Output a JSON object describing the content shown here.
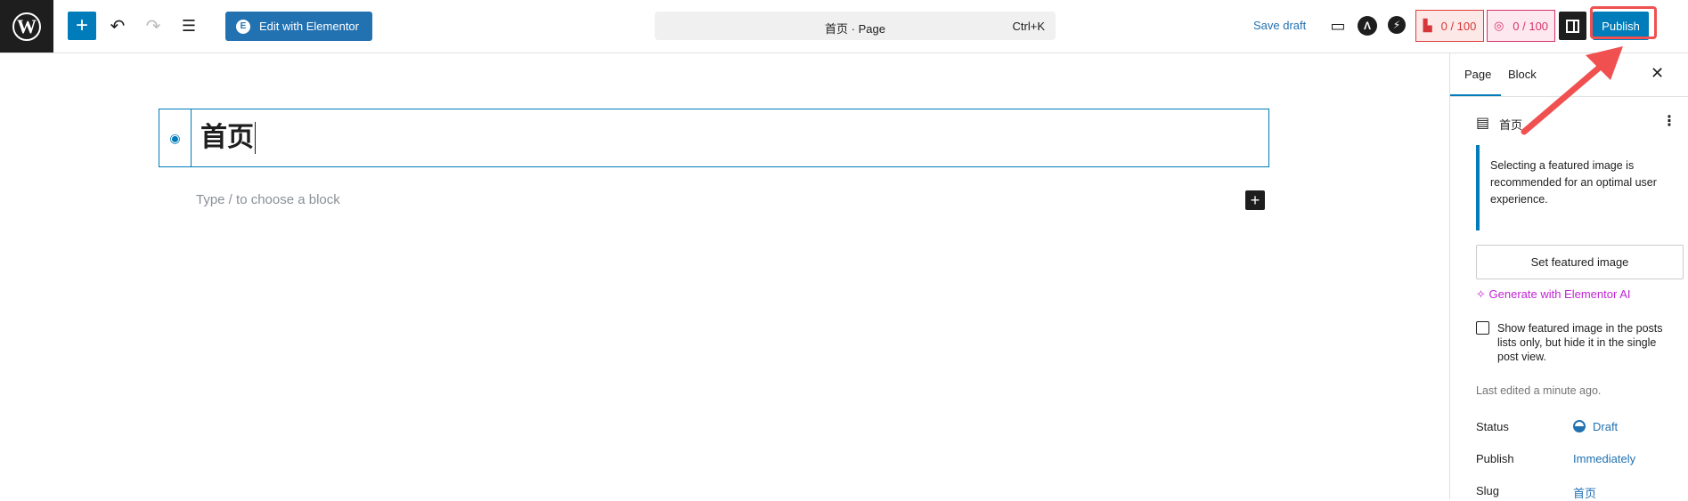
{
  "header": {
    "logo": "WordPress",
    "add_block": "+",
    "elementor_button": "Edit with Elementor",
    "command_bar": {
      "title": "首页 · Page",
      "shortcut": "Ctrl+K"
    },
    "save_draft": "Save draft",
    "seo_score_1": "0 / 100",
    "seo_score_2": "0 / 100",
    "publish": "Publish"
  },
  "editor": {
    "title": "首页",
    "placeholder": "Type / to choose a block"
  },
  "sidebar": {
    "tabs": [
      "Page",
      "Block"
    ],
    "page_title": "首页",
    "notice": "Selecting a featured image is recommended for an optimal user experience.",
    "set_featured_image": "Set featured image",
    "generate_ai": "Generate with Elementor AI",
    "checkbox_label": "Show featured image in the posts lists only, but hide it in the single post view.",
    "last_edited": "Last edited a minute ago.",
    "fields": [
      {
        "label": "Status",
        "value": "Draft"
      },
      {
        "label": "Publish",
        "value": "Immediately"
      },
      {
        "label": "Slug",
        "value": "首页"
      }
    ]
  },
  "colors": {
    "accent": "#007cba",
    "annotation": "#f05050"
  }
}
